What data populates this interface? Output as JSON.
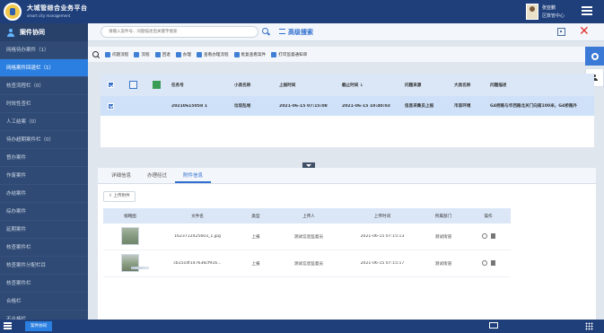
{
  "header": {
    "title": "大城管综合业务平台",
    "subtitle": "smart city management",
    "user_name": "张亚鹏",
    "user_dept": "区数管中心"
  },
  "sidebar": {
    "section_title": "案件协同",
    "items": [
      {
        "label": "网格待办案件（1）",
        "active": false
      },
      {
        "label": "网格案件回退栏（1）",
        "active": true
      },
      {
        "label": "核查流程栏（0）",
        "active": false
      },
      {
        "label": "时效性查栏",
        "active": false
      },
      {
        "label": "人工结案（0）",
        "active": false
      },
      {
        "label": "待办超期案件栏（0）",
        "active": false
      },
      {
        "label": "督办案件",
        "active": false
      },
      {
        "label": "作废案件",
        "active": false
      },
      {
        "label": "办结案件",
        "active": false
      },
      {
        "label": "综办案件",
        "active": false
      },
      {
        "label": "延期案件",
        "active": false
      },
      {
        "label": "核查案件栏",
        "active": false
      },
      {
        "label": "核查案件分配栏目",
        "active": false
      },
      {
        "label": "核查案件栏",
        "active": false
      },
      {
        "label": "合格栏",
        "active": false
      },
      {
        "label": "不合格栏",
        "active": false
      }
    ]
  },
  "search": {
    "placeholder": "请输入案件号、问题描述后关键字搜索",
    "advanced_label": "高级搜索"
  },
  "toolbar": {
    "buttons": [
      "问题流程",
      "流程",
      "回退",
      "办理",
      "查看办理流程",
      "批复查看案件",
      "打印监督通知单"
    ]
  },
  "grid": {
    "columns": [
      "任务号",
      "小类名称",
      "上报时间",
      "截止时间 ↓",
      "问题来源",
      "大类名称",
      "问题描述"
    ],
    "rows": [
      {
        "task_no": "20210615058 1",
        "subtype": "垃圾乱堆",
        "report_time": "2021-06-15 07:15:08",
        "deadline": "2021-06-15 10:40:03",
        "source": "信息采集员上报",
        "category": "市容环境",
        "description": "G4桥路与华西路北关门向南100米，G4桥路外"
      }
    ]
  },
  "detail": {
    "tabs": [
      {
        "label": "详细信息",
        "active": false
      },
      {
        "label": "办理经过",
        "active": false
      },
      {
        "label": "附件信息",
        "active": true
      }
    ],
    "upload_label": "上传附件",
    "columns": [
      "缩略图",
      "文件名",
      "类型",
      "上传人",
      "上传时间",
      "所属部门",
      "操作"
    ],
    "rows": [
      {
        "file": "1623712425603_1.jpg",
        "type": "上报",
        "uploader": "测试信息监督员",
        "time": "2021-06-15 07:15:13",
        "dept": "测试街道"
      },
      {
        "file": "cb15cdf147636cf916...",
        "type": "上报",
        "uploader": "测试信息监督员",
        "time": "2021-06-15 07:15:17",
        "dept": "测试街道"
      }
    ]
  },
  "bottombar": {
    "tab_label": "案件协同"
  }
}
